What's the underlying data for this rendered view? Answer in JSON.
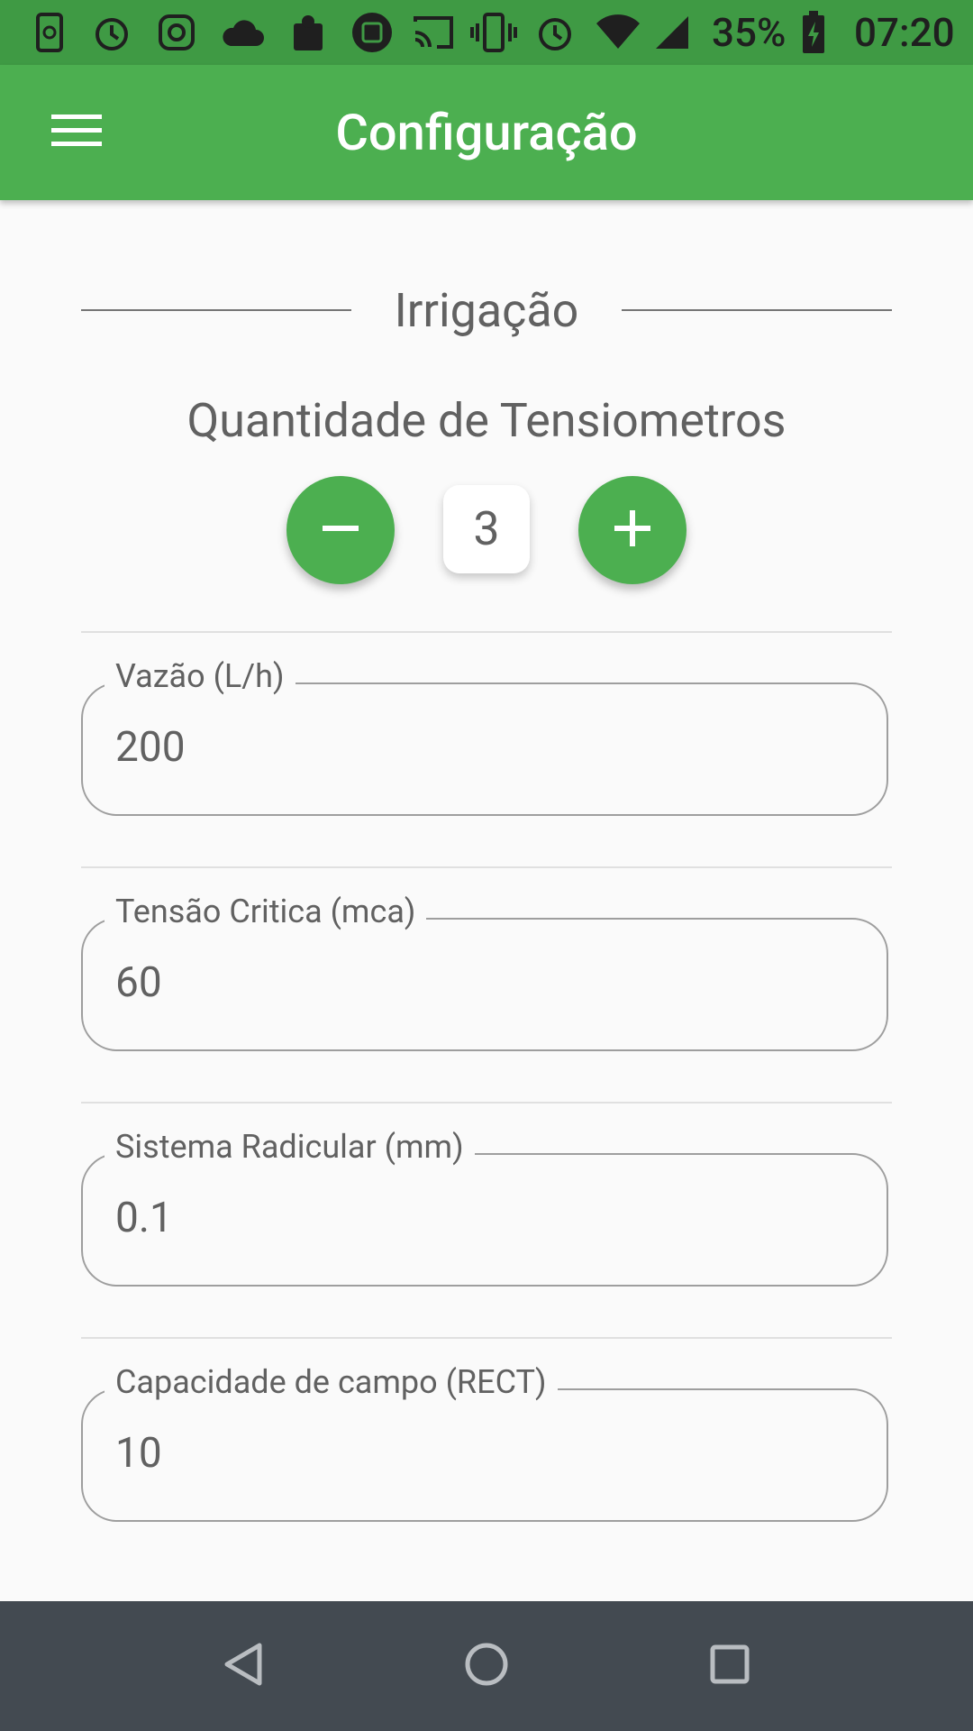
{
  "status_bar": {
    "battery_percent": "35%",
    "time": "07:20",
    "icons": [
      "phone-sync-icon",
      "alarm-icon",
      "instagram-icon",
      "cloud-icon",
      "puzzle-icon",
      "edit-circle-icon",
      "cast-icon",
      "vibrate-icon",
      "alarm-icon",
      "wifi-icon",
      "signal-icon",
      "battery-charging-icon"
    ]
  },
  "app_bar": {
    "title": "Configuração",
    "menu_icon": "menu-icon"
  },
  "irrigation": {
    "section_title": "Irrigação",
    "quantity_label": "Quantidade de Tensiometros",
    "quantity_value": "3",
    "decrement_icon": "minus-icon",
    "increment_icon": "plus-icon",
    "fields": [
      {
        "label": "Vazão (L/h)",
        "value": "200"
      },
      {
        "label": "Tensão Critica (mca)",
        "value": "60"
      },
      {
        "label": "Sistema Radicular (mm)",
        "value": "0.1"
      },
      {
        "label": "Capacidade de campo (RECT)",
        "value": "10"
      }
    ]
  },
  "nav_bar": {
    "buttons": [
      "back-icon",
      "home-icon",
      "recents-icon"
    ]
  },
  "colors": {
    "primary": "#4caf50",
    "status_bar": "#3f9a44",
    "nav_bar": "#434a51",
    "background": "#fafafa"
  }
}
